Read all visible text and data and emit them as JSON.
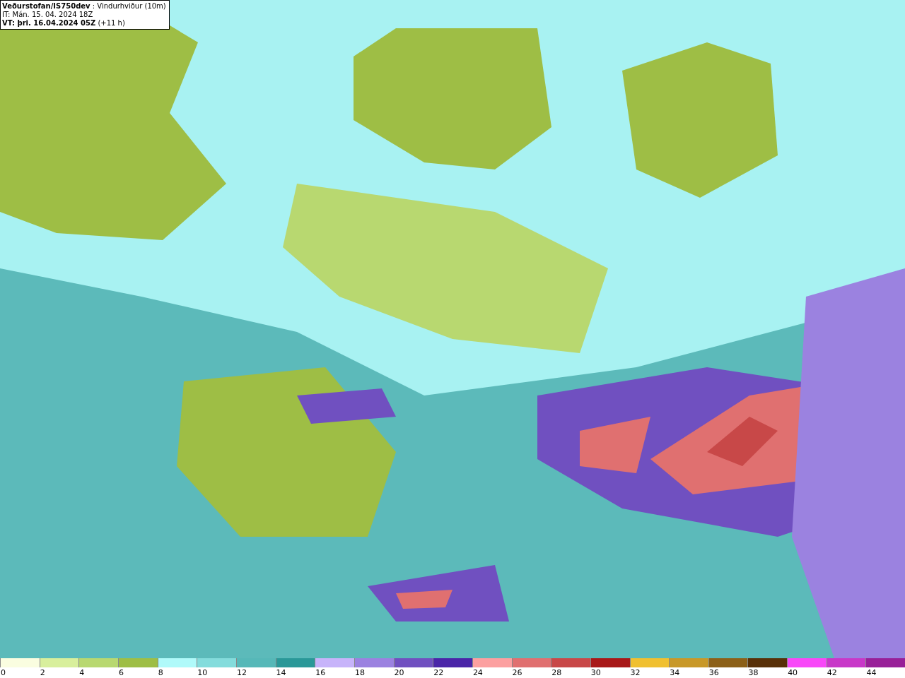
{
  "title_box": {
    "lines": [
      "**Veðurstofan/IS750dev** : Vindurhviður (10m)",
      "IT: Mán. 15. 04. 2024 18Z",
      "**VT: þri. 16.04.2024 05Z** (+11 h)"
    ]
  },
  "legend": [
    {
      "label": "0",
      "color": "#fafde0"
    },
    {
      "label": "2",
      "color": "#d8ef9c"
    },
    {
      "label": "4",
      "color": "#b8d870"
    },
    {
      "label": "6",
      "color": "#9ebe45"
    },
    {
      "label": "8",
      "color": "#b0fafa"
    },
    {
      "label": "10",
      "color": "#84dcdc"
    },
    {
      "label": "12",
      "color": "#56b8b8"
    },
    {
      "label": "14",
      "color": "#2a9898"
    },
    {
      "label": "16",
      "color": "#c7b4fa"
    },
    {
      "label": "18",
      "color": "#9b82e0"
    },
    {
      "label": "20",
      "color": "#7050c0"
    },
    {
      "label": "22",
      "color": "#4a25a8"
    },
    {
      "label": "24",
      "color": "#fca0a0"
    },
    {
      "label": "26",
      "color": "#e07070"
    },
    {
      "label": "28",
      "color": "#c84848"
    },
    {
      "label": "30",
      "color": "#a81818"
    },
    {
      "label": "32",
      "color": "#f0c030"
    },
    {
      "label": "34",
      "color": "#c89828"
    },
    {
      "label": "36",
      "color": "#8c6018"
    },
    {
      "label": "38",
      "color": "#583008"
    },
    {
      "label": "40",
      "color": "#f848f8"
    },
    {
      "label": "42",
      "color": "#c838c8"
    },
    {
      "label": "44",
      "color": "#982098"
    }
  ]
}
